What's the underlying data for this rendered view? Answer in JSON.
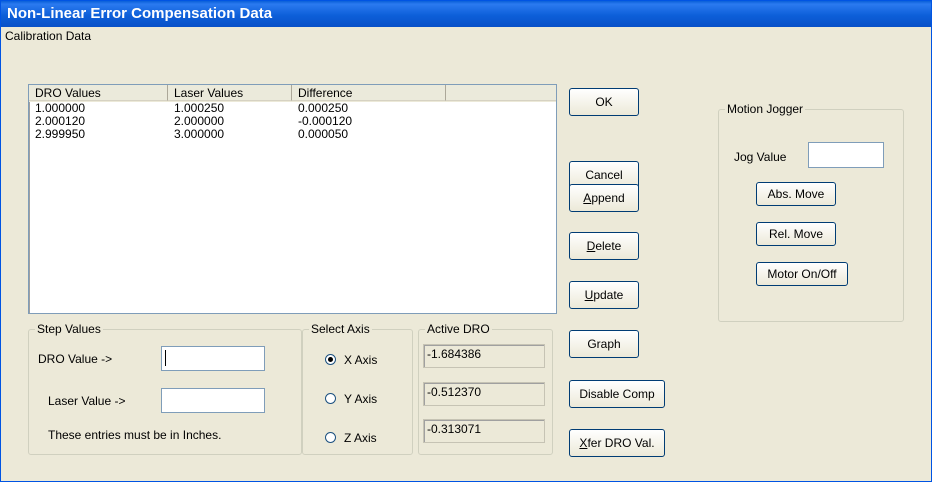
{
  "window": {
    "title": "Non-Linear Error Compensation Data"
  },
  "caption": "Calibration Data",
  "table": {
    "columns": [
      "DRO Values",
      "Laser Values",
      "Difference",
      ""
    ],
    "rows": [
      [
        "1.000000",
        "1.000250",
        "0.000250"
      ],
      [
        "2.000120",
        "2.000000",
        "-0.000120"
      ],
      [
        "2.999950",
        "3.000000",
        "0.000050"
      ]
    ]
  },
  "step_values": {
    "legend": "Step Values",
    "dro_label": "DRO Value ->",
    "dro_value": "",
    "laser_label": "Laser Value ->",
    "laser_value": "",
    "note": "These entries must be in Inches."
  },
  "select_axis": {
    "legend": "Select Axis",
    "options": [
      "X Axis",
      "Y Axis",
      "Z Axis"
    ],
    "selected": "X Axis"
  },
  "active_dro": {
    "legend": "Active DRO",
    "values": [
      "-1.684386",
      "-0.512370",
      "-0.313071"
    ]
  },
  "buttons": {
    "ok": "OK",
    "cancel": "Cancel",
    "append": {
      "mnemonic": "A",
      "rest": "ppend"
    },
    "delete": {
      "mnemonic": "D",
      "rest": "elete"
    },
    "update": {
      "mnemonic": "U",
      "rest": "pdate"
    },
    "graph": "Graph",
    "disable_comp": "Disable Comp",
    "xfer": {
      "mnemonic": "X",
      "rest": "fer DRO Val."
    }
  },
  "motion_jogger": {
    "legend": "Motion Jogger",
    "jog_label": "Jog Value",
    "jog_value": "",
    "abs_move": "Abs. Move",
    "rel_move": "Rel. Move",
    "motor": "Motor On/Off"
  },
  "colors": {
    "titlebar": "#0a5fd8",
    "dialog_bg": "#ece9d8",
    "button_border": "#003c74"
  }
}
